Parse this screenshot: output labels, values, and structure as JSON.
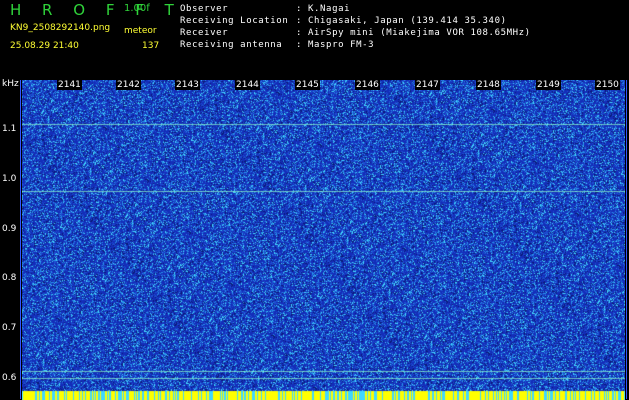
{
  "header": {
    "brand": "H R O F F T",
    "version": "1.00f",
    "filename": "KN9_2508292140.png",
    "source": "meteor",
    "datetime": "25.08.29 21:40",
    "count": "137"
  },
  "meta": {
    "rows": [
      {
        "key": "Observer",
        "value": "K.Nagai"
      },
      {
        "key": "Receiving Location",
        "value": "Chigasaki, Japan (139.414 35.340)"
      },
      {
        "key": "Receiver",
        "value": "AirSpy mini (Miakejima VOR 108.65MHz)"
      },
      {
        "key": "Receiving antenna",
        "value": "Maspro FM-3"
      }
    ]
  },
  "axis": {
    "unit": "kHz",
    "y_ticks": [
      "1.1",
      "1.0",
      "0.9",
      "0.8",
      "0.7",
      "0.6"
    ],
    "x_ticks": [
      "2141",
      "2142",
      "2143",
      "2144",
      "2145",
      "2146",
      "2147",
      "2148",
      "2149",
      "2150"
    ]
  },
  "colors": {
    "brand": "#2fd33a",
    "label_yellow": "#ffff33",
    "background": "#1a2fb8",
    "noise_cyan": "#3fd7ff",
    "line_green": "#8fffcf",
    "base_strip": "#ffff00"
  }
}
